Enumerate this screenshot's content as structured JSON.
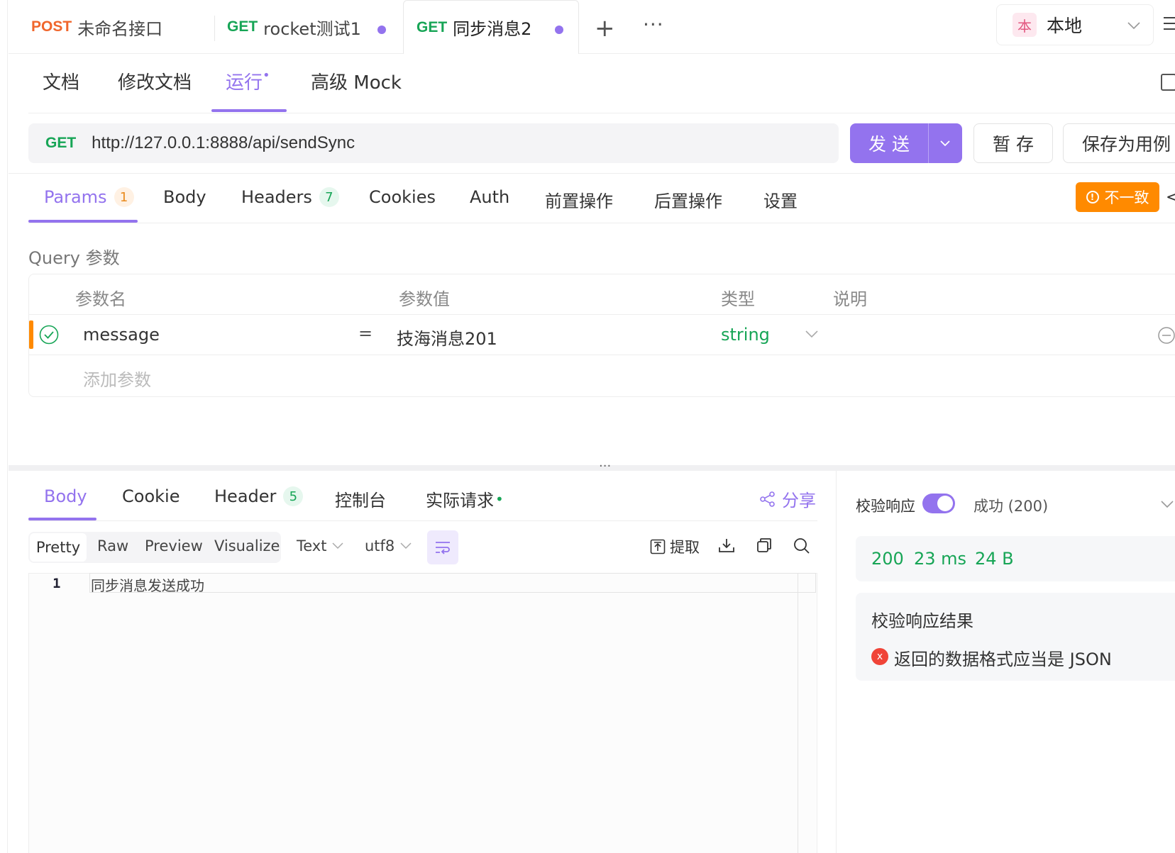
{
  "tabs": [
    {
      "method": "POST",
      "name": "未命名接口"
    },
    {
      "method": "GET",
      "name": "rocket测试1"
    },
    {
      "method": "GET",
      "name": "同步消息2"
    }
  ],
  "env": {
    "badge": "本",
    "name": "本地"
  },
  "subtabs": [
    "文档",
    "修改文档",
    "运行",
    "高级 Mock"
  ],
  "request": {
    "method": "GET",
    "url": "http://127.0.0.1:8888/api/sendSync"
  },
  "buttons": {
    "send": "发 送",
    "save": "暂 存",
    "save_case": "保存为用例"
  },
  "param_tabs": [
    {
      "label": "Params",
      "count": "1"
    },
    {
      "label": "Body"
    },
    {
      "label": "Headers",
      "count": "7"
    },
    {
      "label": "Cookies"
    },
    {
      "label": "Auth"
    },
    {
      "label": "前置操作"
    },
    {
      "label": "后置操作"
    },
    {
      "label": "设置"
    }
  ],
  "inconsistent": "不一致",
  "query": {
    "title": "Query 参数",
    "headers": [
      "参数名",
      "参数值",
      "类型",
      "说明"
    ],
    "rows": [
      {
        "name": "message",
        "eq": "=",
        "value": "技海消息201",
        "type": "string"
      }
    ],
    "add_placeholder": "添加参数"
  },
  "response": {
    "tabs": [
      {
        "label": "Body"
      },
      {
        "label": "Cookie"
      },
      {
        "label": "Header",
        "count": "5"
      },
      {
        "label": "控制台"
      },
      {
        "label": "实际请求"
      }
    ],
    "share": "分享",
    "view_modes": [
      "Pretty",
      "Raw",
      "Preview",
      "Visualize"
    ],
    "format": "Text",
    "encoding": "utf8",
    "extract": "提取",
    "code_line_no": "1",
    "code_line": "同步消息发送成功"
  },
  "validate": {
    "label": "校验响应",
    "status_label": "成功 (200)",
    "status": "200",
    "time": "23 ms",
    "size": "24 B",
    "result_title": "校验响应结果",
    "result_msg": "返回的数据格式应当是 JSON"
  },
  "colors": {
    "accent": "#9373ee",
    "get": "#17a556",
    "post": "#f0662c",
    "warn": "#ff8a00",
    "error": "#f04438"
  }
}
